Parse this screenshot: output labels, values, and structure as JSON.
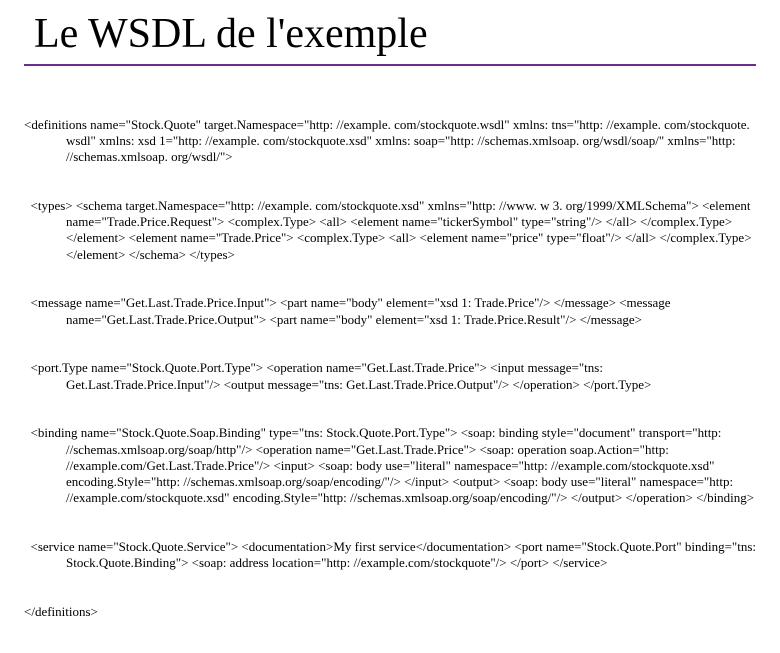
{
  "title": "Le WSDL de l'exemple",
  "code": {
    "l1": "<definitions name=\"Stock.Quote\" target.Namespace=\"http: //example. com/stockquote.wsdl\" xmlns: tns=\"http: //example. com/stockquote. wsdl\" xmlns: xsd 1=\"http: //example. com/stockquote.xsd\" xmlns: soap=\"http: //schemas.xmlsoap. org/wsdl/soap/\" xmlns=\"http: //schemas.xmlsoap. org/wsdl/\">",
    "l2": "  <types> <schema target.Namespace=\"http: //example. com/stockquote.xsd\" xmlns=\"http: //www. w 3. org/1999/XMLSchema\"> <element name=\"Trade.Price.Request\"> <complex.Type> <all> <element name=\"tickerSymbol\" type=\"string\"/> </all> </complex.Type> </element> <element name=\"Trade.Price\"> <complex.Type> <all> <element name=\"price\" type=\"float\"/> </all> </complex.Type> </element> </schema> </types>",
    "l3": "  <message name=\"Get.Last.Trade.Price.Input\"> <part name=\"body\" element=\"xsd 1: Trade.Price\"/> </message> <message name=\"Get.Last.Trade.Price.Output\"> <part name=\"body\" element=\"xsd 1: Trade.Price.Result\"/> </message>",
    "l4": "  <port.Type name=\"Stock.Quote.Port.Type\"> <operation name=\"Get.Last.Trade.Price\"> <input message=\"tns: Get.Last.Trade.Price.Input\"/> <output message=\"tns: Get.Last.Trade.Price.Output\"/> </operation> </port.Type>",
    "l5": "  <binding name=\"Stock.Quote.Soap.Binding\" type=\"tns: Stock.Quote.Port.Type\"> <soap: binding style=\"document\" transport=\"http: //schemas.xmlsoap.org/soap/http\"/> <operation name=\"Get.Last.Trade.Price\"> <soap: operation soap.Action=\"http: //example.com/Get.Last.Trade.Price\"/> <input> <soap: body use=\"literal\" namespace=\"http: //example.com/stockquote.xsd\" encoding.Style=\"http: //schemas.xmlsoap.org/soap/encoding/\"/> </input> <output> <soap: body use=\"literal\" namespace=\"http: //example.com/stockquote.xsd\" encoding.Style=\"http: //schemas.xmlsoap.org/soap/encoding/\"/> </output> </operation> </binding>",
    "l6": "  <service name=\"Stock.Quote.Service\"> <documentation>My first service</documentation> <port name=\"Stock.Quote.Port\" binding=\"tns: Stock.Quote.Binding\"> <soap: address location=\"http: //example.com/stockquote\"/> </port> </service>",
    "l7": "</definitions>"
  }
}
